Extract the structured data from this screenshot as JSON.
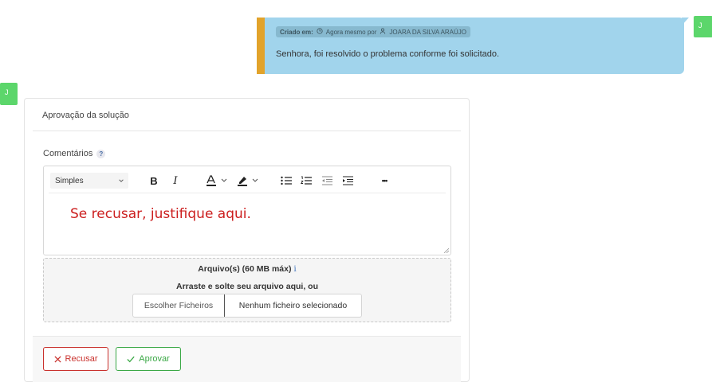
{
  "message": {
    "avatar_initial": "J",
    "created_label": "Criado em:",
    "time_text": "Agora mesmo por",
    "author": "JOARA DA SILVA ARAÚJO",
    "body": "Senhora, foi resolvido o problema conforme foi solicitado.",
    "bubble_color": "#a1d4ec",
    "accent_color": "#e2a32b"
  },
  "reply_avatar_initial": "J",
  "card": {
    "title": "Aprovação da solução",
    "comments_label": "Comentários",
    "help_glyph": "?"
  },
  "editor": {
    "style_value": "Simples",
    "content": "Se recusar, justifique aqui.",
    "content_color": "#cc1f1f",
    "toolbar_icons": [
      "bold-icon",
      "italic-icon",
      "text-color-icon",
      "highlight-icon",
      "bulleted-list-icon",
      "numbered-list-icon",
      "outdent-icon",
      "indent-icon",
      "more-icon"
    ],
    "bold_glyph": "B",
    "italic_glyph": "I",
    "more_glyph": "•••"
  },
  "upload": {
    "title": "Arquivo(s) (60 MB máx)",
    "info_glyph": "i",
    "instructions": "Arraste e solte seu arquivo aqui, ou",
    "choose_label": "Escolher Ficheiros",
    "no_file_label": "Nenhum ficheiro selecionado"
  },
  "actions": {
    "reject_label": "Recusar",
    "approve_label": "Aprovar",
    "reject_color": "#c9302c",
    "approve_color": "#3aa845"
  }
}
